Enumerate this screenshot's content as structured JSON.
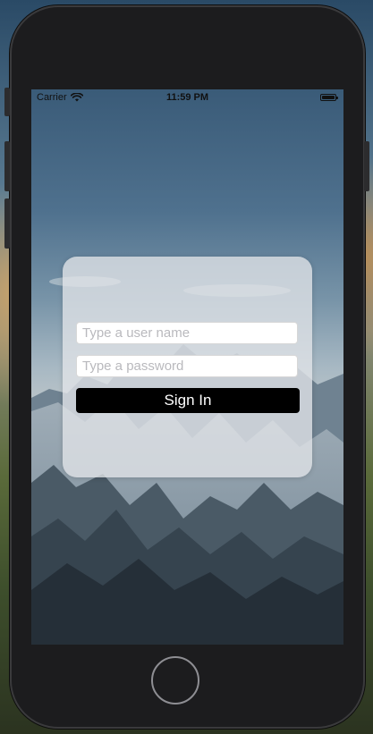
{
  "status_bar": {
    "carrier": "Carrier",
    "time": "11:59 PM",
    "wifi_icon": "wifi-icon",
    "battery_icon": "battery-icon",
    "battery_level": 1.0
  },
  "login": {
    "username_placeholder": "Type a user name",
    "password_placeholder": "Type a password",
    "username_value": "",
    "password_value": "",
    "sign_in_label": "Sign In"
  },
  "colors": {
    "button_bg": "#000000",
    "button_text": "#ffffff",
    "card_bg": "#e1e4e8",
    "device_frame": "#1c1c1e"
  }
}
